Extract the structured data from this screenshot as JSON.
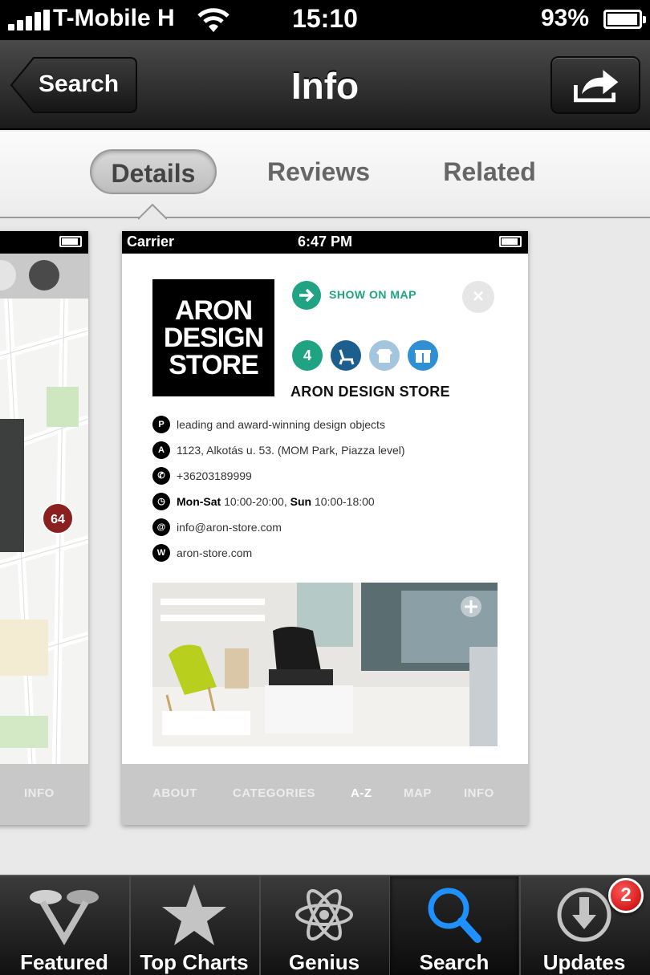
{
  "status_bar": {
    "carrier": "T-Mobile H",
    "time": "15:10",
    "battery": "93%"
  },
  "navbar": {
    "back_label": "Search",
    "title": "Info"
  },
  "segments": [
    {
      "label": "Details",
      "active": true
    },
    {
      "label": "Reviews",
      "active": false
    },
    {
      "label": "Related",
      "active": false
    }
  ],
  "screenshot": {
    "status": {
      "carrier": "Carrier",
      "time": "6:47 PM"
    },
    "logo_lines": [
      "ARON",
      "DESIGN",
      "STORE"
    ],
    "show_on_map": "SHOW ON MAP",
    "close_symbol": "×",
    "category_count": "4",
    "store_name": "ARON DESIGN STORE",
    "info": [
      {
        "icon": "P",
        "text": "leading and award-winning design objects"
      },
      {
        "icon": "A",
        "text": "1123, Alkotás u. 53. (MOM Park, Piazza level)"
      },
      {
        "icon": "phone",
        "text": "+36203189999"
      },
      {
        "icon": "clock",
        "bold1": "Mon-Sat",
        "text1": " 10:00-20:00, ",
        "bold2": "Sun",
        "text2": " 10:00-18:00"
      },
      {
        "icon": "@",
        "text": "info@aron-store.com"
      },
      {
        "icon": "W",
        "text": "aron-store.com"
      }
    ],
    "tabs": [
      "ABOUT",
      "CATEGORIES",
      "A-Z",
      "MAP",
      "INFO"
    ],
    "active_tab": "A-Z"
  },
  "left_screenshot": {
    "map_marker": "64",
    "tab": "INFO"
  },
  "tabbar": {
    "tabs": [
      {
        "label": "Featured",
        "icon": "featured-icon"
      },
      {
        "label": "Top Charts",
        "icon": "star-icon"
      },
      {
        "label": "Genius",
        "icon": "atom-icon"
      },
      {
        "label": "Search",
        "icon": "search-icon",
        "active": true
      },
      {
        "label": "Updates",
        "icon": "download-icon"
      }
    ],
    "updates_badge": "2"
  },
  "colors": {
    "accent_green": "#1fa383",
    "search_blue": "#1e90ff",
    "badge_red": "#d40000"
  }
}
